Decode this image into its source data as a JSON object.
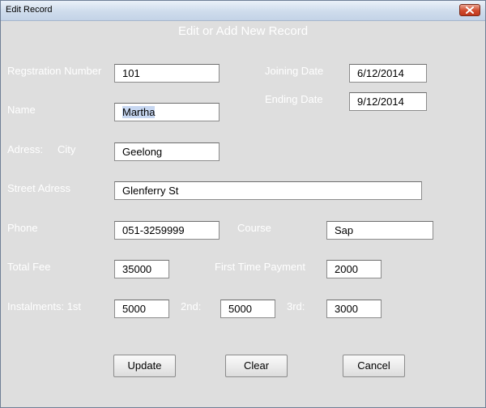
{
  "window": {
    "title": "Edit Record"
  },
  "form": {
    "heading": "Edit or Add New Record",
    "labels": {
      "registration_number": "Regstration Number",
      "name": "Name",
      "address": "Adress:",
      "city": "City",
      "street_address": "Street Adress",
      "phone": "Phone",
      "total_fee": "Total Fee",
      "instalments": "Instalments: 1st",
      "second": "2nd:",
      "third": "3rd:",
      "joining_date": "Joining Date",
      "ending_date": "Ending Date",
      "course": "Course",
      "first_time_payment": "First Time Payment"
    },
    "values": {
      "registration_number": "101",
      "name": "Martha",
      "city": "Geelong",
      "street_address": "Glenferry St",
      "phone": "051-3259999",
      "total_fee": "35000",
      "instalment_1": "5000",
      "instalment_2": "5000",
      "instalment_3": "3000",
      "joining_date": "6/12/2014",
      "ending_date": "9/12/2014",
      "course": "Sap",
      "first_time_payment": "2000"
    },
    "buttons": {
      "update": "Update",
      "clear": "Clear",
      "cancel": "Cancel"
    }
  },
  "colors": {
    "label_text": "#ffffff",
    "form_background": "#dedede",
    "selection": "#c7d7f1"
  },
  "icons": {
    "close": "close-x-icon"
  }
}
